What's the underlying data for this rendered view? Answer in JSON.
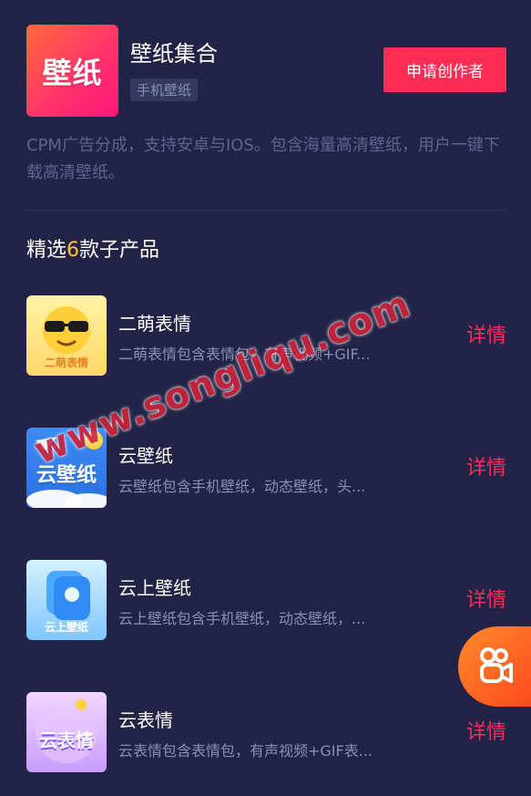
{
  "app": {
    "logo_text": "壁纸",
    "title": "壁纸集合",
    "tag": "手机壁纸",
    "apply_button": "申请创作者",
    "description": "CPM广告分成，支持安卓与IOS。包含海量高清壁纸，用户一键下载高清壁纸。"
  },
  "section": {
    "title_prefix": "精选",
    "count": "6",
    "title_suffix": "款子产品"
  },
  "products": [
    {
      "name": "二萌表情",
      "summary": "二萌表情包含表情包，有声视频+GIF...",
      "thumb_text": "二萌表情",
      "detail": "详情"
    },
    {
      "name": "云壁纸",
      "summary": "云壁纸包含手机壁纸，动态壁纸，头...",
      "thumb_text": "云壁纸",
      "detail": "详情"
    },
    {
      "name": "云上壁纸",
      "summary": "云上壁纸包含手机壁纸，动态壁纸，...",
      "thumb_text": "云上壁纸",
      "detail": "详情"
    },
    {
      "name": "云表情",
      "summary": "云表情包含表情包，有声视频+GIF表...",
      "thumb_text": "云表情",
      "detail": "详情"
    }
  ],
  "floating_button_icon": "kuaishou-logo-icon",
  "watermark": "www.songliqu.com",
  "colors": {
    "background": "#222347",
    "accent": "#ff2c55",
    "highlight": "#ffc72b"
  }
}
